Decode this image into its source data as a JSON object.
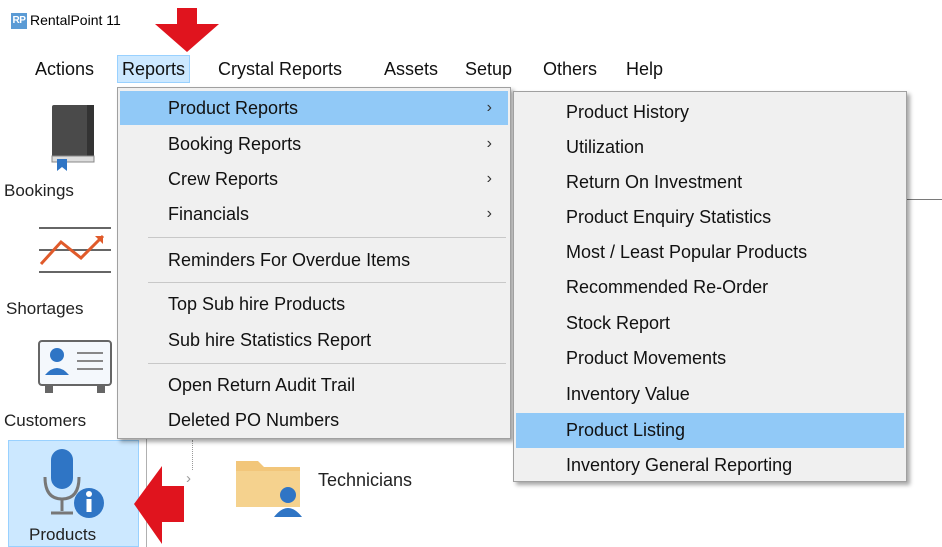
{
  "window": {
    "logo_text": "RP",
    "title": "RentalPoint 11"
  },
  "menubar": {
    "items": [
      "Actions",
      "Reports",
      "Crystal Reports",
      "Assets",
      "Setup",
      "Others",
      "Help"
    ],
    "active": "Reports"
  },
  "sidebar": {
    "items": [
      {
        "label": "Bookings",
        "icon": "book-icon"
      },
      {
        "label": "Shortages",
        "icon": "trend-chart-icon"
      },
      {
        "label": "Customers",
        "icon": "contact-card-icon"
      },
      {
        "label": "Products",
        "icon": "microphone-info-icon",
        "selected": true
      }
    ]
  },
  "reports_menu": {
    "groups": [
      [
        {
          "label": "Product Reports",
          "submenu": true,
          "highlighted": true
        },
        {
          "label": "Booking Reports",
          "submenu": true
        },
        {
          "label": "Crew Reports",
          "submenu": true
        },
        {
          "label": "Financials",
          "submenu": true
        }
      ],
      [
        {
          "label": "Reminders For Overdue Items"
        }
      ],
      [
        {
          "label": "Top Sub hire Products"
        },
        {
          "label": "Sub hire Statistics Report"
        }
      ],
      [
        {
          "label": "Open Return Audit Trail"
        },
        {
          "label": "Deleted PO Numbers"
        }
      ]
    ],
    "arrow_glyph": "›"
  },
  "product_reports_submenu": {
    "items": [
      "Product History",
      "Utilization",
      "Return On Investment",
      "Product Enquiry Statistics",
      "Most / Least Popular Products",
      "Recommended Re-Order",
      "Stock Report",
      "Product Movements",
      "Inventory Value",
      "Product Listing",
      "Inventory General Reporting"
    ],
    "highlighted": "Product Listing"
  },
  "content": {
    "tree_expander": "›",
    "folder_label": "Technicians",
    "folder_icon": "folder-user-icon"
  },
  "colors": {
    "menu_highlight": "#91c9f7",
    "menubar_active": "#cce8ff",
    "annotation_arrow": "#e0141e"
  }
}
